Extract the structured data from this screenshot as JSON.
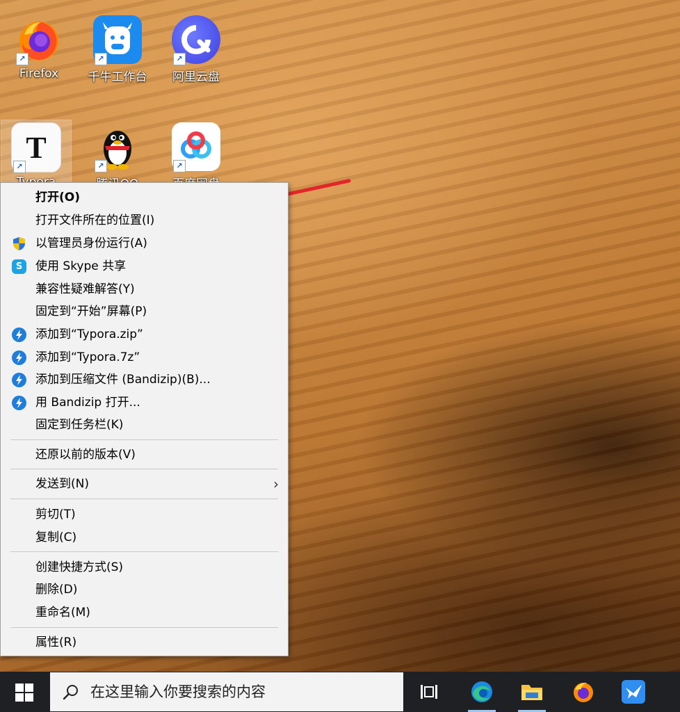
{
  "desktop": {
    "icons": [
      {
        "label": "Firefox",
        "icon": "firefox-icon",
        "color": "#ff7a18"
      },
      {
        "label": "千牛工作台",
        "icon": "qianniu-icon",
        "color": "#1b8bf0"
      },
      {
        "label": "阿里云盘",
        "icon": "aliyun-drive-icon",
        "color": "#4b58f5"
      },
      {
        "label": "Typora",
        "icon": "typora-icon",
        "color": "#ffffff"
      },
      {
        "label": "腾讯QQ",
        "icon": "qq-penguin-icon",
        "color": "#000000"
      },
      {
        "label": "百度网盘",
        "icon": "baidu-netdisk-icon",
        "color": "#2fa0f5"
      }
    ]
  },
  "context_menu": {
    "items": {
      "open": "打开(O)",
      "open_location": "打开文件所在的位置(I)",
      "run_as_admin": "以管理员身份运行(A)",
      "share_skype": "使用 Skype 共享",
      "troubleshoot": "兼容性疑难解答(Y)",
      "pin_start": "固定到“开始”屏幕(P)",
      "add_zip": "添加到“Typora.zip”",
      "add_7z": "添加到“Typora.7z”",
      "add_archive": "添加到压缩文件 (Bandizip)(B)...",
      "open_bandizip": "用 Bandizip 打开...",
      "pin_taskbar": "固定到任务栏(K)",
      "restore_versions": "还原以前的版本(V)",
      "send_to": "发送到(N)",
      "cut": "剪切(T)",
      "copy": "复制(C)",
      "create_shortcut": "创建快捷方式(S)",
      "delete": "删除(D)",
      "rename": "重命名(M)",
      "properties": "属性(R)"
    },
    "icons": {
      "skype": "S",
      "shield_colors": [
        "#2a73d6",
        "#f1c40f"
      ],
      "bandizip_color": "#1f7ed9",
      "skype_color": "#1ba3e5"
    }
  },
  "annotation": {
    "arrow_color": "#e3262a"
  },
  "taskbar": {
    "search_placeholder": "在这里输入你要搜索的内容",
    "apps": [
      "task-view-icon",
      "edge-icon",
      "file-explorer-icon",
      "firefox-icon",
      "feishu-icon"
    ]
  }
}
